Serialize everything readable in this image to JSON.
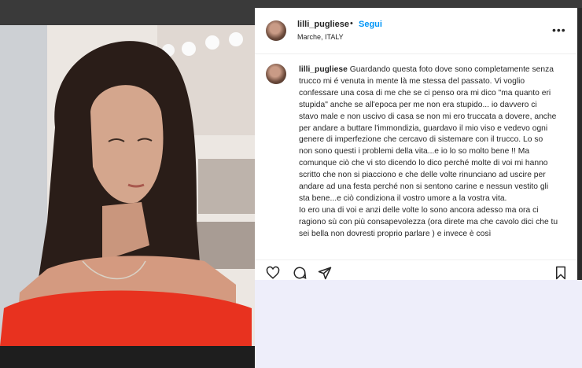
{
  "post": {
    "username": "lilli_pugliese",
    "separator": "•",
    "follow_label": "Segui",
    "location": "Marche, ITALY",
    "more_label": "•••"
  },
  "caption": {
    "username": "lilli_pugliese",
    "paragraph1": "Guardando questa foto dove sono completamente senza trucco mi é venuta in mente là me stessa del passato. Vi voglio confessare una cosa di me che se ci penso ora mi dico \"ma quanto eri stupida\" anche se all'epoca per me non era stupido... io davvero ci stavo male e non uscivo di casa se non mi ero truccata a dovere, anche per andare a buttare l'immondizia, guardavo il mio viso e vedevo ogni genere di imperfezione che cercavo di sistemare con il trucco. Lo so non sono questi i problemi della vita...e io lo so molto bene !! Ma comunque ciò che vi sto dicendo lo dico perché molte di voi mi hanno scritto che non si piacciono e che delle volte rinunciano ad uscire per andare ad una festa perché non si sentono carine e nessun vestito gli sta bene...e ciò condiziona il vostro umore a la vostra vita.",
    "paragraph2": "Io ero una di voi e anzi delle volte lo sono ancora adesso ma ora ci ragiono sù con più consapevolezza (ora direte ma che cavolo dici che tu sei bella non dovresti proprio parlare ) e invece è così"
  },
  "actions": [
    "heart-icon",
    "comment-icon",
    "share-icon",
    "bookmark-icon"
  ],
  "colors": {
    "link": "#0095f6",
    "text": "#262626",
    "top_dress": "#e8321f"
  }
}
